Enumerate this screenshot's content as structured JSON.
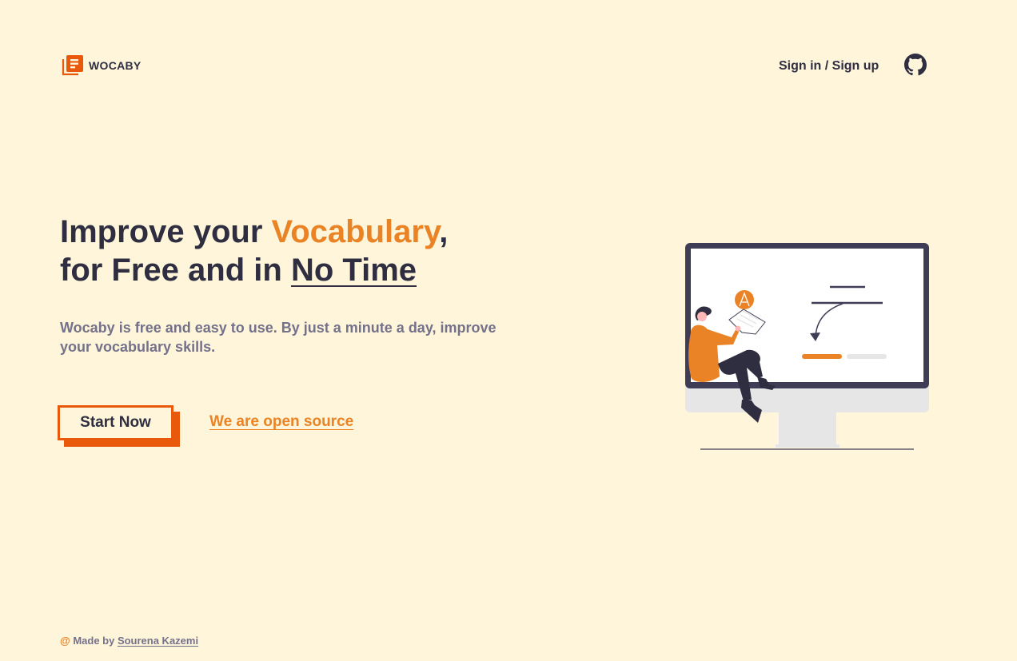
{
  "brand": {
    "name": "WOCABY",
    "icon": "book-icon",
    "color": "#e8590c"
  },
  "nav": {
    "signin_label": "Sign in / Sign up",
    "github_icon": "github-icon"
  },
  "hero": {
    "title_part1": "Improve your ",
    "title_accent": "Vocabulary",
    "title_comma": ",",
    "title_part2": "for Free and in ",
    "title_underlined": "No Time",
    "subtitle": "Wocaby is free and easy to use. By just a minute a day, improve your vocabulary skills.",
    "cta_label": "Start Now",
    "oss_link_label": "We are open source",
    "illustration": "person-with-monitor-illustration"
  },
  "footer": {
    "at_symbol": "@",
    "made_by": "Made by ",
    "author": "Sourena Kazemi"
  },
  "colors": {
    "background": "#fff5da",
    "text": "#2f2e41",
    "accent": "#e98325",
    "button": "#e8590c",
    "muted": "#74718a"
  }
}
